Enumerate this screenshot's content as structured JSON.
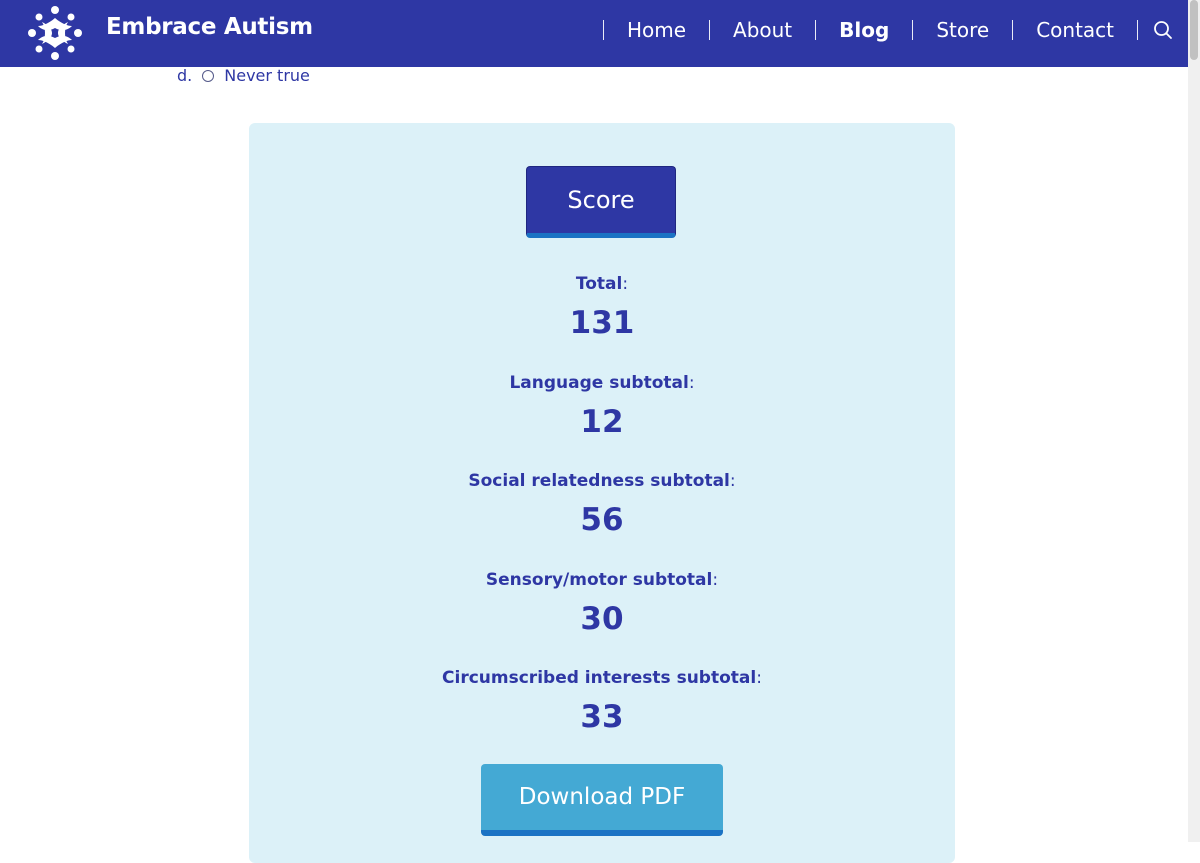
{
  "header": {
    "brand": "Embrace Autism",
    "nav": [
      {
        "label": "Home",
        "active": false
      },
      {
        "label": "About",
        "active": false
      },
      {
        "label": "Blog",
        "active": true
      },
      {
        "label": "Store",
        "active": false
      },
      {
        "label": "Contact",
        "active": false
      }
    ],
    "search_icon": "search-icon",
    "logo_icon": "embrace-autism-logo-icon",
    "background_color": "#2e37a4"
  },
  "question": {
    "option_letter": "d.",
    "option_text": "Never true"
  },
  "results": {
    "score_button": "Score",
    "items": [
      {
        "label": "Total",
        "value": "131"
      },
      {
        "label": "Language subtotal",
        "value": "12"
      },
      {
        "label": "Social relatedness subtotal",
        "value": "56"
      },
      {
        "label": "Sensory/motor subtotal",
        "value": "30"
      },
      {
        "label": "Circumscribed interests subtotal",
        "value": "33"
      }
    ],
    "colon": ":",
    "download_button": "Download PDF",
    "panel_color": "#dcf1f8",
    "accent_color": "#44a9d4"
  }
}
